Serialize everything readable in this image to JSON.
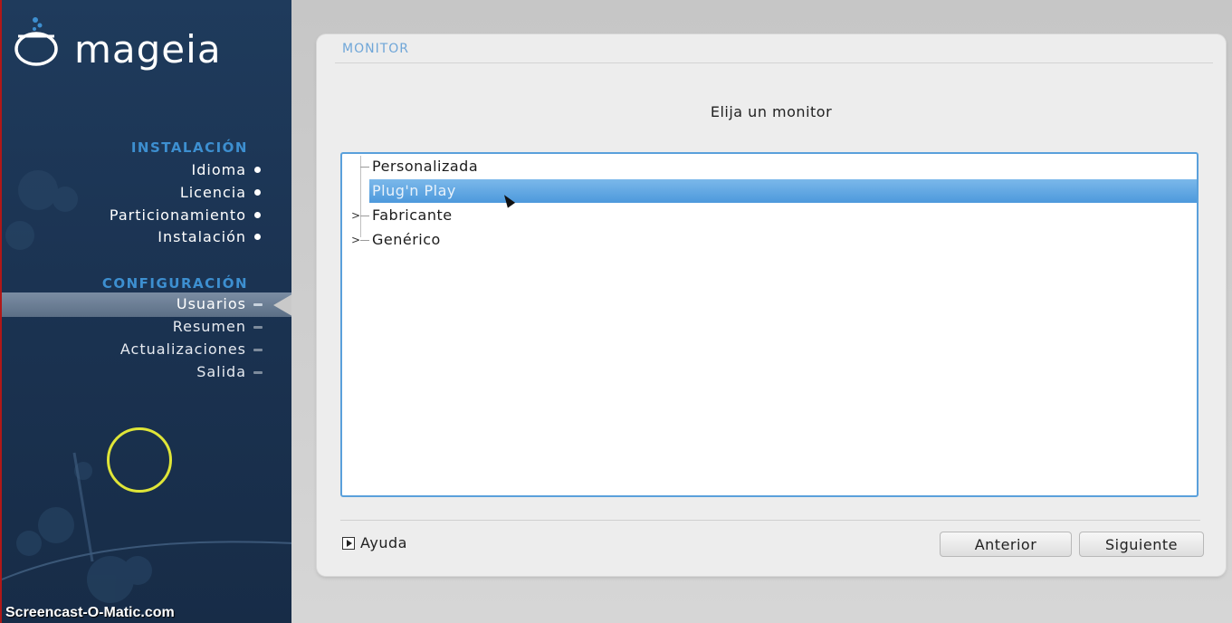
{
  "app": {
    "brand": "mageia",
    "watermark": "Screencast-O-Matic.com"
  },
  "sidebar": {
    "sections": [
      {
        "title": "INSTALACIÓN",
        "items": [
          {
            "label": "Idioma",
            "state": "done"
          },
          {
            "label": "Licencia",
            "state": "done"
          },
          {
            "label": "Particionamiento",
            "state": "done"
          },
          {
            "label": "Instalación",
            "state": "done"
          }
        ]
      },
      {
        "title": "CONFIGURACIÓN",
        "items": [
          {
            "label": "Usuarios",
            "state": "active"
          },
          {
            "label": "Resumen",
            "state": "pending"
          },
          {
            "label": "Actualizaciones",
            "state": "pending"
          },
          {
            "label": "Salida",
            "state": "pending"
          }
        ]
      }
    ]
  },
  "panel": {
    "title": "MONITOR",
    "prompt": "Elija un monitor",
    "tree": {
      "selected_index": 1,
      "items": [
        {
          "label": "Personalizada",
          "expandable": false
        },
        {
          "label": "Plug'n Play",
          "expandable": false
        },
        {
          "label": "Fabricante",
          "expandable": true,
          "expander": ">"
        },
        {
          "label": "Genérico",
          "expandable": true,
          "expander": ">"
        }
      ]
    },
    "help_label": "Ayuda",
    "back_label": "Anterior",
    "next_label": "Siguiente"
  },
  "colors": {
    "sidebar_bg": "#1b3352",
    "section_title": "#3d8fd0",
    "selection": "#4d99dc",
    "tree_border": "#5aa0db",
    "panel_title": "#6fa6d8"
  }
}
